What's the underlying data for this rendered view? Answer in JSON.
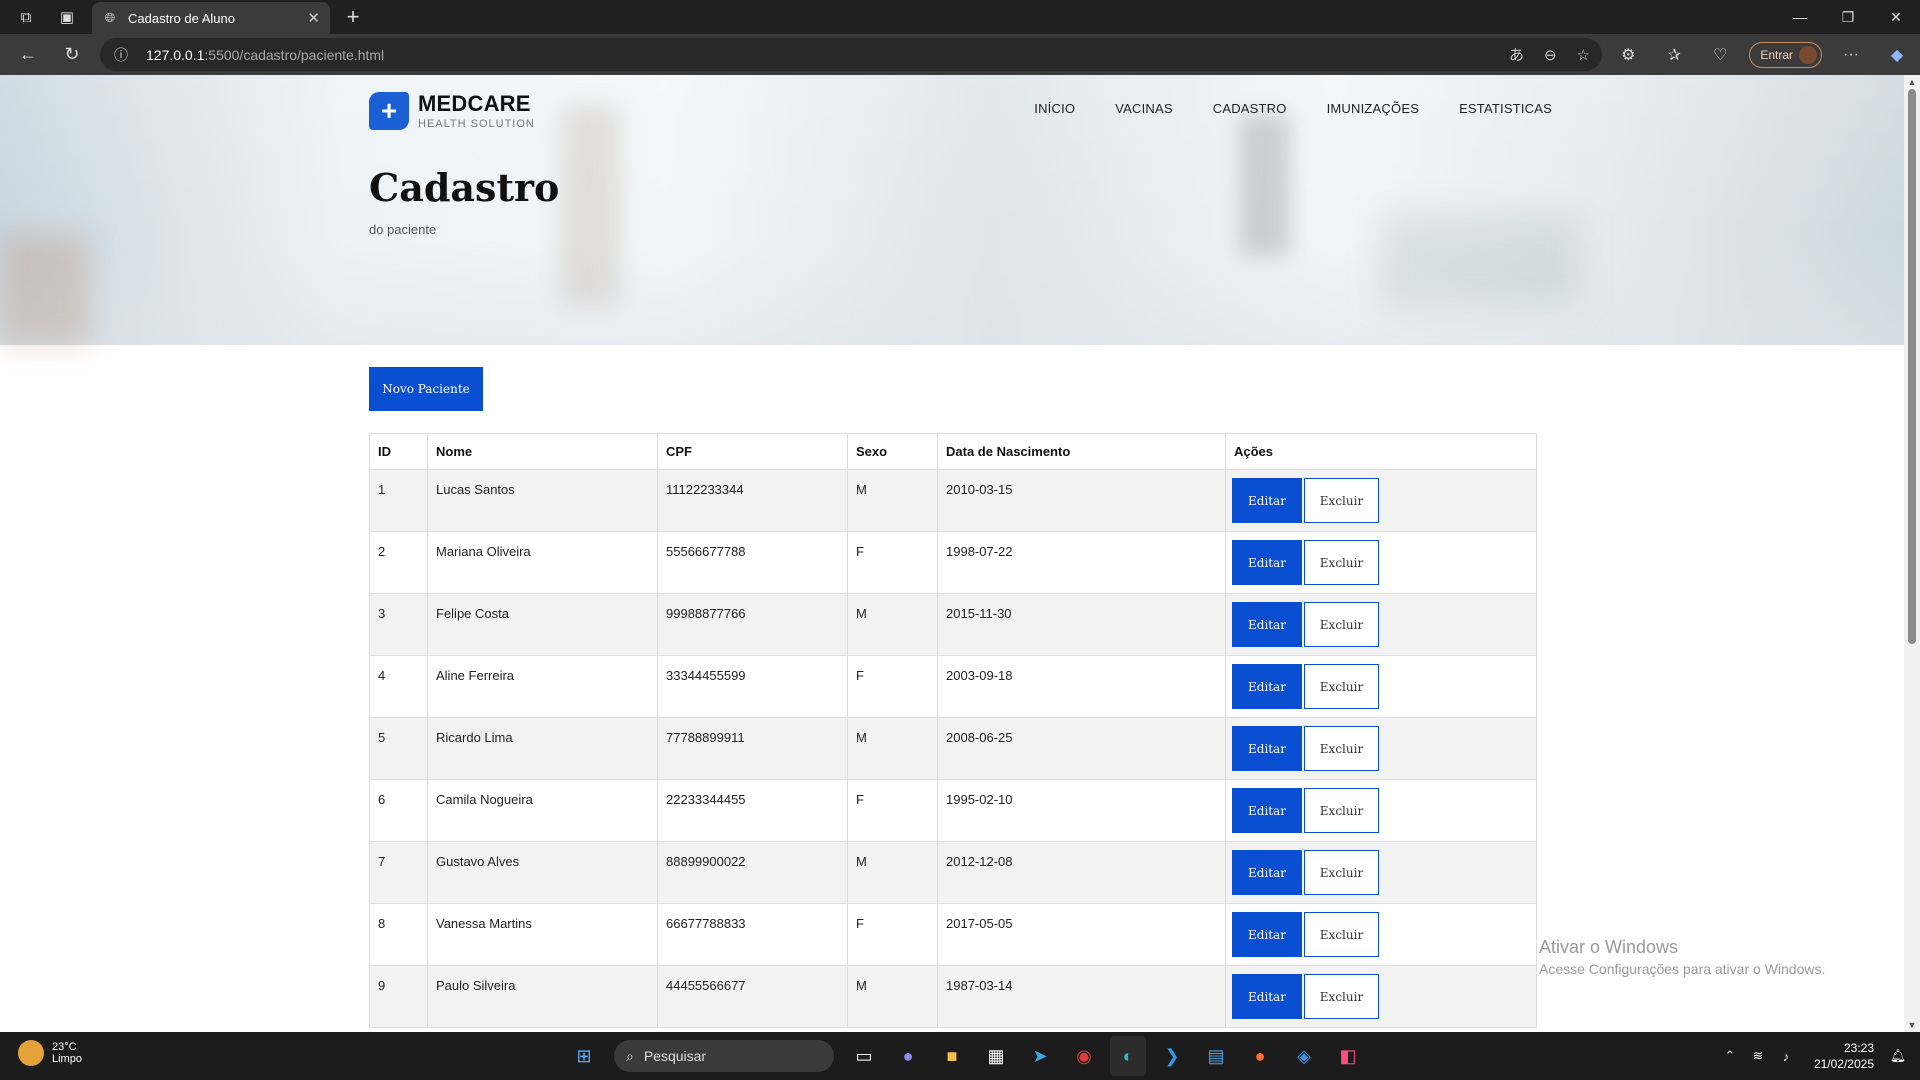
{
  "browser": {
    "tab_title": "Cadastro de Aluno",
    "url_host": "127.0.0.1",
    "url_path": ":5500/cadastro/paciente.html",
    "profile_button": "Entrar"
  },
  "site": {
    "brand": "MEDCARE",
    "tagline": "HEALTH SOLUTION",
    "nav": [
      "INÍCIO",
      "VACINAS",
      "CADASTRO",
      "IMUNIZAÇÕES",
      "ESTATISTICAS"
    ],
    "title": "Cadastro",
    "subtitle": "do paciente"
  },
  "new_button_label": "Novo Paciente",
  "table": {
    "headers": [
      "ID",
      "Nome",
      "CPF",
      "Sexo",
      "Data de Nascimento",
      "Ações"
    ],
    "edit_label": "Editar",
    "delete_label": "Excluir",
    "rows": [
      {
        "id": "1",
        "nome": "Lucas Santos",
        "cpf": "11122233344",
        "sexo": "M",
        "nascimento": "2010-03-15"
      },
      {
        "id": "2",
        "nome": "Mariana Oliveira",
        "cpf": "55566677788",
        "sexo": "F",
        "nascimento": "1998-07-22"
      },
      {
        "id": "3",
        "nome": "Felipe Costa",
        "cpf": "99988877766",
        "sexo": "M",
        "nascimento": "2015-11-30"
      },
      {
        "id": "4",
        "nome": "Aline Ferreira",
        "cpf": "33344455599",
        "sexo": "F",
        "nascimento": "2003-09-18"
      },
      {
        "id": "5",
        "nome": "Ricardo Lima",
        "cpf": "77788899911",
        "sexo": "M",
        "nascimento": "2008-06-25"
      },
      {
        "id": "6",
        "nome": "Camila Nogueira",
        "cpf": "22233344455",
        "sexo": "F",
        "nascimento": "1995-02-10"
      },
      {
        "id": "7",
        "nome": "Gustavo Alves",
        "cpf": "88899900022",
        "sexo": "M",
        "nascimento": "2012-12-08"
      },
      {
        "id": "8",
        "nome": "Vanessa Martins",
        "cpf": "66677788833",
        "sexo": "F",
        "nascimento": "2017-05-05"
      },
      {
        "id": "9",
        "nome": "Paulo Silveira",
        "cpf": "44455566677",
        "sexo": "M",
        "nascimento": "1987-03-14"
      }
    ]
  },
  "watermark": {
    "line1": "Ativar o Windows",
    "line2": "Acesse Configurações para ativar o Windows."
  },
  "taskbar": {
    "temperature": "23°C",
    "weather": "Limpo",
    "search_placeholder": "Pesquisar",
    "time": "23:23",
    "date": "21/02/2025"
  },
  "colors": {
    "accent": "#0a4fd1",
    "browser_bg": "#202020",
    "toolbar_bg": "#3b3b3b"
  }
}
